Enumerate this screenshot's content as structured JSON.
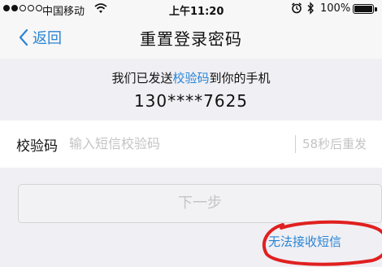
{
  "status_bar": {
    "carrier": "中国移动",
    "time": "上午11:20",
    "battery_percent": "100%",
    "signal_bars_filled": 2,
    "signal_bars_total": 5,
    "battery_level": 1.0,
    "icons": [
      "signal-dots-icon",
      "wifi-icon",
      "alarm-icon",
      "bluetooth-icon",
      "battery-icon"
    ]
  },
  "nav": {
    "back_label": "返回",
    "title": "重置登录密码"
  },
  "info": {
    "line_prefix": "我们已发送",
    "line_highlight": "校验码",
    "line_suffix": "到你的手机",
    "phone": "130****7625"
  },
  "code_field": {
    "label": "校验码",
    "placeholder": "输入短信校验码",
    "value": "",
    "resend": "58秒后重发"
  },
  "next_button": {
    "label": "下一步"
  },
  "cant_receive": {
    "label": "无法接收短信"
  },
  "colors": {
    "accent": "#2a84d4",
    "background": "#efeff4",
    "placeholder": "#c4c4c4",
    "annotation_circle": "#e02020"
  }
}
